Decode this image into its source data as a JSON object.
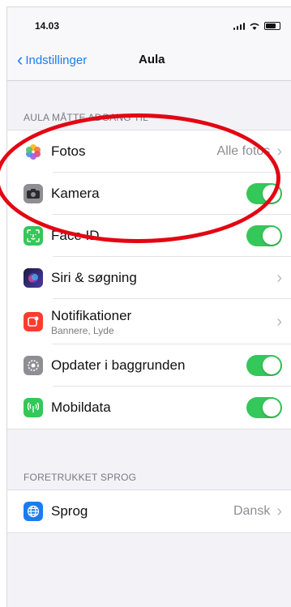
{
  "status": {
    "time": "14.03"
  },
  "nav": {
    "back_label": "Indstillinger",
    "title": "Aula"
  },
  "section1": {
    "header": "AULA MÅTTE ADGANG TIL",
    "rows": [
      {
        "label": "Fotos",
        "value": "Alle fotos",
        "icon": "photos-icon"
      },
      {
        "label": "Kamera",
        "toggle": true,
        "icon": "camera-icon"
      },
      {
        "label": "Face ID",
        "toggle": true,
        "icon": "face-id-icon"
      },
      {
        "label": "Siri & søgning",
        "icon": "siri-icon"
      },
      {
        "label": "Notifikationer",
        "sublabel": "Bannere, Lyde",
        "icon": "notifications-icon"
      },
      {
        "label": "Opdater i baggrunden",
        "toggle": true,
        "icon": "gear-icon"
      },
      {
        "label": "Mobildata",
        "toggle": true,
        "icon": "cellular-icon"
      }
    ]
  },
  "section2": {
    "header": "FORETRUKKET SPROG",
    "rows": [
      {
        "label": "Sprog",
        "value": "Dansk",
        "icon": "globe-icon"
      }
    ]
  },
  "colors": {
    "accent": "#1a7cf0",
    "toggle_on": "#34c759",
    "annotation": "#e30613"
  }
}
